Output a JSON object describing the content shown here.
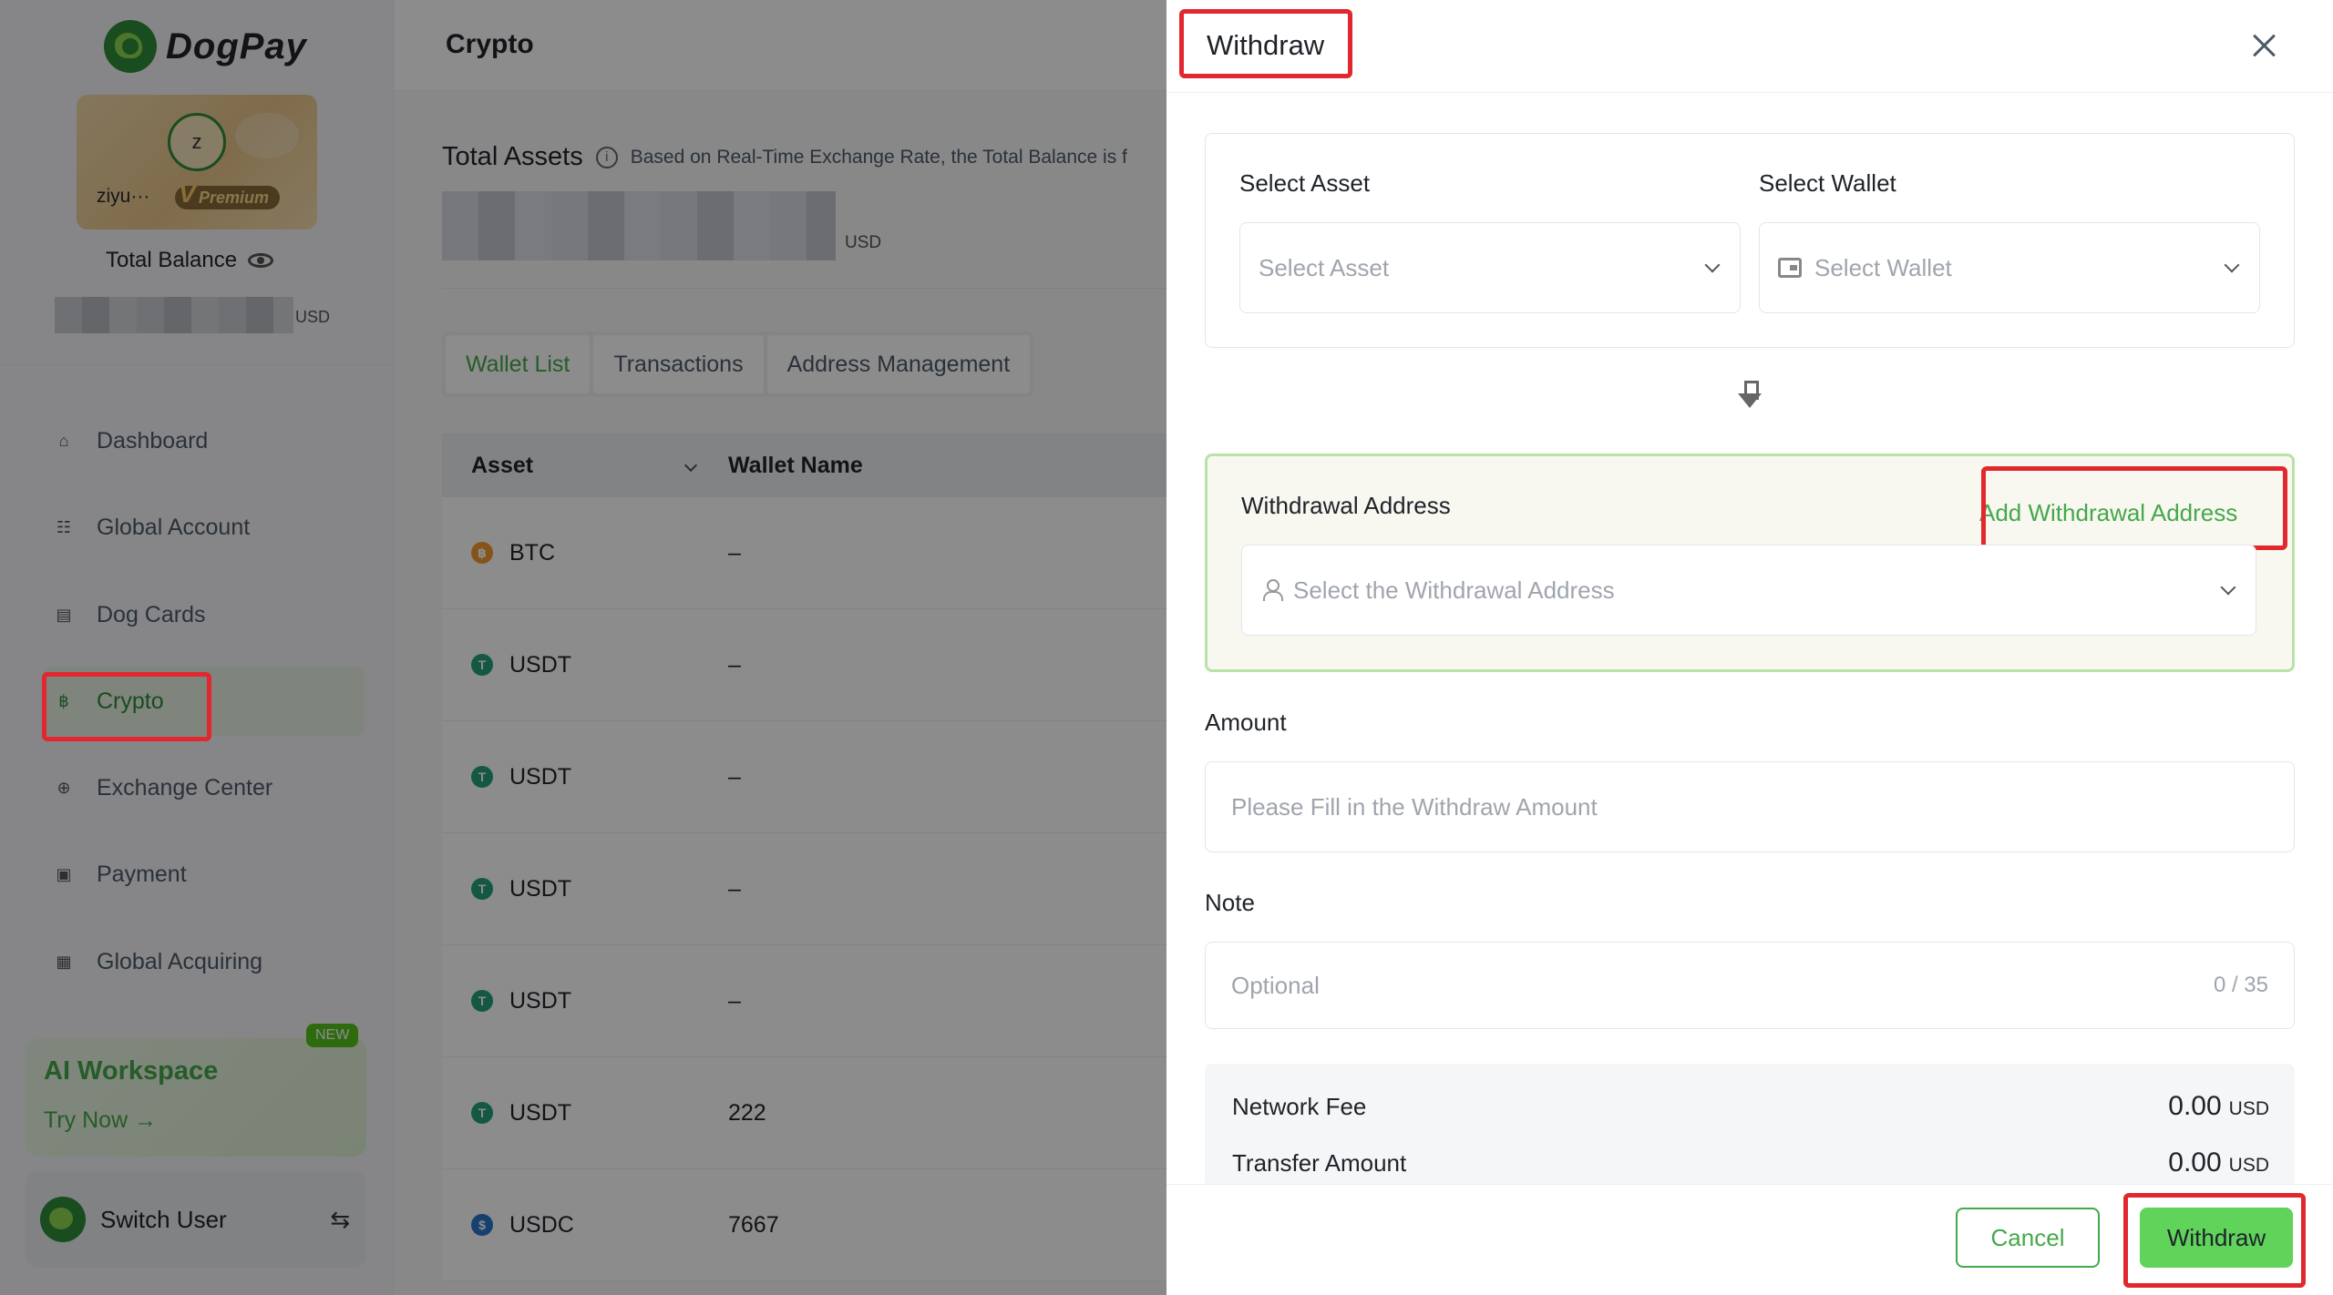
{
  "sidebar": {
    "brand": "DogPay",
    "user": {
      "initial": "z",
      "name": "ziyu···",
      "tier": "Premium"
    },
    "total_balance_label": "Total Balance",
    "balance_currency": "USD",
    "nav": [
      {
        "label": "Dashboard",
        "icon": "home-icon"
      },
      {
        "label": "Global Account",
        "icon": "bank-icon"
      },
      {
        "label": "Dog Cards",
        "icon": "card-icon"
      },
      {
        "label": "Crypto",
        "icon": "bitcoin-icon",
        "active": true
      },
      {
        "label": "Exchange Center",
        "icon": "exchange-icon"
      },
      {
        "label": "Payment",
        "icon": "wallet-icon"
      },
      {
        "label": "Global Acquiring",
        "icon": "acquiring-icon"
      }
    ],
    "ai_workspace": {
      "title": "AI Workspace",
      "cta": "Try Now →",
      "badge": "NEW"
    },
    "switch_user": "Switch User"
  },
  "main": {
    "title": "Crypto",
    "total_assets_label": "Total Assets",
    "total_assets_note": "Based on Real-Time Exchange Rate, the Total Balance is f",
    "total_assets_currency": "USD",
    "tabs": [
      "Wallet List",
      "Transactions",
      "Address Management"
    ],
    "table": {
      "headers": [
        "Asset",
        "Wallet Name"
      ],
      "rows": [
        {
          "asset": "BTC",
          "coin": "btc",
          "wallet": "–"
        },
        {
          "asset": "USDT",
          "coin": "usdt",
          "wallet": "–"
        },
        {
          "asset": "USDT",
          "coin": "usdt",
          "wallet": "–"
        },
        {
          "asset": "USDT",
          "coin": "usdt",
          "wallet": "–"
        },
        {
          "asset": "USDT",
          "coin": "usdt",
          "wallet": "–"
        },
        {
          "asset": "USDT",
          "coin": "usdt",
          "wallet": "222"
        },
        {
          "asset": "USDC",
          "coin": "usdc",
          "wallet": "7667"
        }
      ]
    }
  },
  "drawer": {
    "title": "Withdraw",
    "select_asset_label": "Select Asset",
    "select_asset_placeholder": "Select Asset",
    "select_wallet_label": "Select Wallet",
    "select_wallet_placeholder": "Select Wallet",
    "withdrawal_address_label": "Withdrawal Address",
    "add_withdrawal_address": "Add Withdrawal Address",
    "withdrawal_address_placeholder": "Select the Withdrawal Address",
    "amount_label": "Amount",
    "amount_placeholder": "Please Fill in the Withdraw Amount",
    "note_label": "Note",
    "note_placeholder": "Optional",
    "note_counter": "0 / 35",
    "network_fee_label": "Network Fee",
    "network_fee_value": "0.00",
    "transfer_amount_label": "Transfer Amount",
    "transfer_amount_value": "0.00",
    "currency": "USD",
    "cancel_label": "Cancel",
    "withdraw_label": "Withdraw"
  },
  "colors": {
    "accent": "#45a84a",
    "highlight": "#e0282e",
    "primary_button": "#5fd35a"
  }
}
